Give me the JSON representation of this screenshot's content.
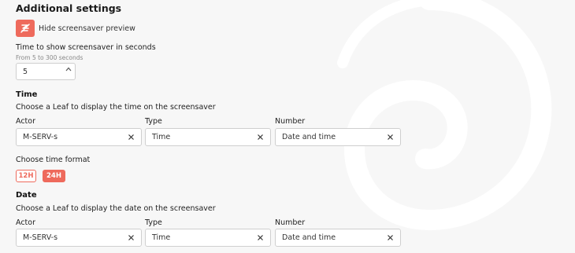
{
  "additional_settings": {
    "title": "Additional settings",
    "hide_preview_label": "Hide screensaver preview",
    "time_to_show_label": "Time to show screensaver in seconds",
    "time_to_show_hint": "From 5 to 300 seconds",
    "time_to_show_value": "5"
  },
  "time_section": {
    "title": "Time",
    "description": "Choose a Leaf to display the time on the screensaver",
    "actor_label": "Actor",
    "actor_value": "M-SERV-s",
    "type_label": "Type",
    "type_value": "Time",
    "number_label": "Number",
    "number_value": "Date and time",
    "format_label": "Choose time format",
    "format_12": "12H",
    "format_24": "24H",
    "format_selected": "24H"
  },
  "date_section": {
    "title": "Date",
    "description": "Choose a Leaf to display the date on the screensaver",
    "actor_label": "Actor",
    "actor_value": "M-SERV-s",
    "type_label": "Type",
    "type_value": "Time",
    "number_label": "Number",
    "number_value": "Date and time"
  },
  "colors": {
    "accent": "#ee6a5c",
    "background": "#f7f7f7",
    "border": "#cfcfcf"
  },
  "icons": {
    "hide_preview": "hide-preview-icon",
    "clear": "close-icon",
    "stepper_up": "chevron-up-icon",
    "background": "swirl-logo-watermark"
  }
}
